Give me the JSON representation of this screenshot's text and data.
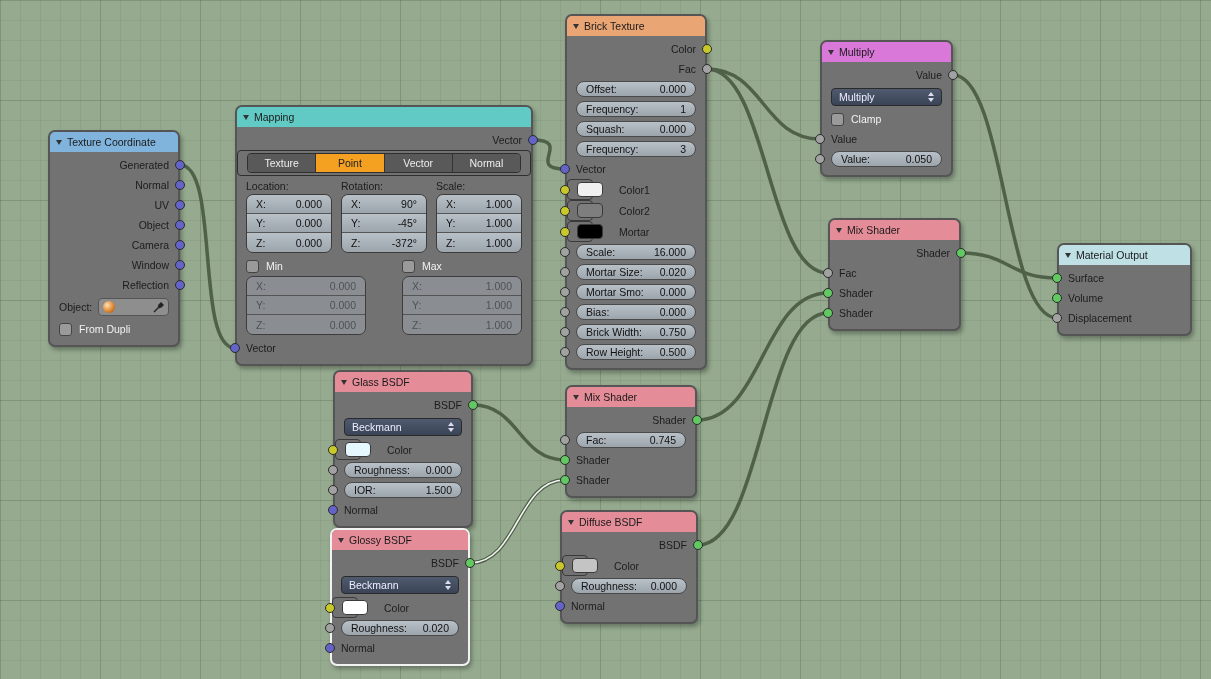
{
  "nodes": [
    {
      "title": "Texture Coordinate",
      "color": "#80b4dc",
      "selected": false,
      "rows": [
        {
          "kind": "output",
          "label": "Generated",
          "socket": {
            "kind": "vector"
          }
        },
        {
          "kind": "output",
          "label": "Normal",
          "socket": {
            "kind": "vector"
          }
        },
        {
          "kind": "output",
          "label": "UV",
          "socket": {
            "kind": "vector"
          }
        },
        {
          "kind": "output",
          "label": "Object",
          "socket": {
            "kind": "vector"
          }
        },
        {
          "kind": "output",
          "label": "Camera",
          "socket": {
            "kind": "vector"
          }
        },
        {
          "kind": "output",
          "label": "Window",
          "socket": {
            "kind": "vector"
          }
        },
        {
          "kind": "output",
          "label": "Reflection",
          "socket": {
            "kind": "vector"
          }
        },
        {
          "kind": "object",
          "label": "Object:"
        },
        {
          "kind": "checkbox",
          "label": "From Dupli",
          "checked": false
        }
      ]
    },
    {
      "title": "Mapping",
      "color": "#62cac4",
      "selected": false,
      "rows": [
        {
          "kind": "output",
          "label": "Vector",
          "socket": {
            "kind": "vector"
          }
        },
        {
          "kind": "tabs",
          "tabs": [
            {
              "label": "Texture",
              "selected": false
            },
            {
              "label": "Point",
              "selected": true
            },
            {
              "label": "Vector",
              "selected": false
            },
            {
              "label": "Normal",
              "selected": false
            }
          ]
        },
        {
          "kind": "vectors",
          "groups": [
            {
              "label": "Location:",
              "fields": [
                {
                  "label": "X:",
                  "value": "0.000"
                },
                {
                  "label": "Y:",
                  "value": "0.000"
                },
                {
                  "label": "Z:",
                  "value": "0.000"
                }
              ]
            },
            {
              "label": "Rotation:",
              "fields": [
                {
                  "label": "X:",
                  "value": "90°"
                },
                {
                  "label": "Y:",
                  "value": "-45°"
                },
                {
                  "label": "Z:",
                  "value": "-372°"
                }
              ]
            },
            {
              "label": "Scale:",
              "fields": [
                {
                  "label": "X:",
                  "value": "1.000"
                },
                {
                  "label": "Y:",
                  "value": "1.000"
                },
                {
                  "label": "Z:",
                  "value": "1.000"
                }
              ]
            }
          ]
        },
        {
          "kind": "bounds",
          "groups": [
            {
              "label": "Min",
              "checked": false,
              "disabled": true,
              "fields": [
                {
                  "label": "X:",
                  "value": "0.000"
                },
                {
                  "label": "Y:",
                  "value": "0.000"
                },
                {
                  "label": "Z:",
                  "value": "0.000"
                }
              ]
            },
            {
              "label": "Max",
              "checked": false,
              "disabled": true,
              "fields": [
                {
                  "label": "X:",
                  "value": "1.000"
                },
                {
                  "label": "Y:",
                  "value": "1.000"
                },
                {
                  "label": "Z:",
                  "value": "1.000"
                }
              ]
            }
          ]
        },
        {
          "kind": "input",
          "label": "Vector",
          "socket": {
            "kind": "vector"
          }
        }
      ]
    },
    {
      "title": "Brick Texture",
      "color": "#e9a674",
      "selected": false,
      "rows": [
        {
          "kind": "output",
          "label": "Color",
          "socket": {
            "kind": "color"
          }
        },
        {
          "kind": "output",
          "label": "Fac",
          "socket": {
            "kind": "value"
          }
        },
        {
          "kind": "field",
          "label": "Offset:",
          "value": "0.000"
        },
        {
          "kind": "field",
          "label": "Frequency:",
          "value": "1"
        },
        {
          "kind": "field",
          "label": "Squash:",
          "value": "0.000"
        },
        {
          "kind": "field",
          "label": "Frequency:",
          "value": "3"
        },
        {
          "kind": "input",
          "label": "Vector",
          "socket": {
            "kind": "vector"
          }
        },
        {
          "kind": "swatch",
          "label": "Color1",
          "color": "#f0f0f0",
          "socket": {
            "kind": "color"
          }
        },
        {
          "kind": "swatch",
          "label": "Color2",
          "color": "#7e7e7e",
          "socket": {
            "kind": "color"
          }
        },
        {
          "kind": "swatch",
          "label": "Mortar",
          "color": "#000000",
          "socket": {
            "kind": "color"
          }
        },
        {
          "kind": "field",
          "label": "Scale:",
          "value": "16.000",
          "socket": {
            "kind": "value"
          }
        },
        {
          "kind": "field",
          "label": "Mortar Size:",
          "value": "0.020",
          "socket": {
            "kind": "value"
          }
        },
        {
          "kind": "field",
          "label": "Mortar Smo:",
          "value": "0.000",
          "socket": {
            "kind": "value"
          }
        },
        {
          "kind": "field",
          "label": "Bias:",
          "value": "0.000",
          "socket": {
            "kind": "value"
          }
        },
        {
          "kind": "field",
          "label": "Brick Width:",
          "value": "0.750",
          "socket": {
            "kind": "value"
          }
        },
        {
          "kind": "field",
          "label": "Row Height:",
          "value": "0.500",
          "socket": {
            "kind": "value"
          }
        }
      ]
    },
    {
      "title": "Multiply",
      "color": "#da78da",
      "selected": false,
      "rows": [
        {
          "kind": "output",
          "label": "Value",
          "socket": {
            "kind": "value"
          }
        },
        {
          "kind": "dropdown",
          "value": "Multiply"
        },
        {
          "kind": "checkbox",
          "label": "Clamp",
          "checked": false
        },
        {
          "kind": "input",
          "label": "Value",
          "socket": {
            "kind": "value"
          }
        },
        {
          "kind": "field",
          "label": "Value:",
          "value": "0.050",
          "socket": {
            "kind": "value"
          }
        }
      ]
    },
    {
      "title": "Mix Shader",
      "color": "#e48c98",
      "selected": false,
      "rows": [
        {
          "kind": "output",
          "label": "Shader",
          "socket": {
            "kind": "shader"
          }
        },
        {
          "kind": "input",
          "label": "Fac",
          "socket": {
            "kind": "value"
          }
        },
        {
          "kind": "input",
          "label": "Shader",
          "socket": {
            "kind": "shader"
          }
        },
        {
          "kind": "input",
          "label": "Shader",
          "socket": {
            "kind": "shader"
          }
        }
      ]
    },
    {
      "title": "Material Output",
      "color": "#bfe0e4",
      "selected": false,
      "rows": [
        {
          "kind": "input",
          "label": "Surface",
          "socket": {
            "kind": "shader"
          }
        },
        {
          "kind": "input",
          "label": "Volume",
          "socket": {
            "kind": "shader"
          }
        },
        {
          "kind": "input",
          "label": "Displacement",
          "socket": {
            "kind": "value"
          }
        }
      ]
    },
    {
      "title": "Glass BSDF",
      "color": "#e48c98",
      "selected": false,
      "rows": [
        {
          "kind": "output",
          "label": "BSDF",
          "socket": {
            "kind": "shader"
          }
        },
        {
          "kind": "dropdown",
          "value": "Beckmann"
        },
        {
          "kind": "swatch",
          "label": "Color",
          "color": "#e6f8ff",
          "socket": {
            "kind": "color"
          }
        },
        {
          "kind": "field",
          "label": "Roughness:",
          "value": "0.000",
          "socket": {
            "kind": "value"
          }
        },
        {
          "kind": "field",
          "label": "IOR:",
          "value": "1.500",
          "socket": {
            "kind": "value"
          }
        },
        {
          "kind": "input",
          "label": "Normal",
          "socket": {
            "kind": "vector"
          }
        }
      ]
    },
    {
      "title": "Glossy BSDF",
      "color": "#e48c98",
      "selected": true,
      "rows": [
        {
          "kind": "output",
          "label": "BSDF",
          "socket": {
            "kind": "shader"
          }
        },
        {
          "kind": "dropdown",
          "value": "Beckmann"
        },
        {
          "kind": "swatch",
          "label": "Color",
          "color": "#ffffff",
          "socket": {
            "kind": "color"
          }
        },
        {
          "kind": "field",
          "label": "Roughness:",
          "value": "0.020",
          "socket": {
            "kind": "value"
          }
        },
        {
          "kind": "input",
          "label": "Normal",
          "socket": {
            "kind": "vector"
          }
        }
      ]
    },
    {
      "title": "Mix Shader",
      "color": "#e48c98",
      "selected": false,
      "rows": [
        {
          "kind": "output",
          "label": "Shader",
          "socket": {
            "kind": "shader"
          }
        },
        {
          "kind": "field",
          "label": "Fac:",
          "value": "0.745",
          "socket": {
            "kind": "value"
          }
        },
        {
          "kind": "input",
          "label": "Shader",
          "socket": {
            "kind": "shader"
          }
        },
        {
          "kind": "input",
          "label": "Shader",
          "socket": {
            "kind": "shader"
          }
        }
      ]
    },
    {
      "title": "Diffuse BSDF",
      "color": "#e48c98",
      "selected": false,
      "rows": [
        {
          "kind": "output",
          "label": "BSDF",
          "socket": {
            "kind": "shader"
          }
        },
        {
          "kind": "swatch",
          "label": "Color",
          "color": "#c4c4c4",
          "socket": {
            "kind": "color"
          }
        },
        {
          "kind": "field",
          "label": "Roughness:",
          "value": "0.000",
          "socket": {
            "kind": "value"
          }
        },
        {
          "kind": "input",
          "label": "Normal",
          "socket": {
            "kind": "vector"
          }
        }
      ]
    }
  ]
}
